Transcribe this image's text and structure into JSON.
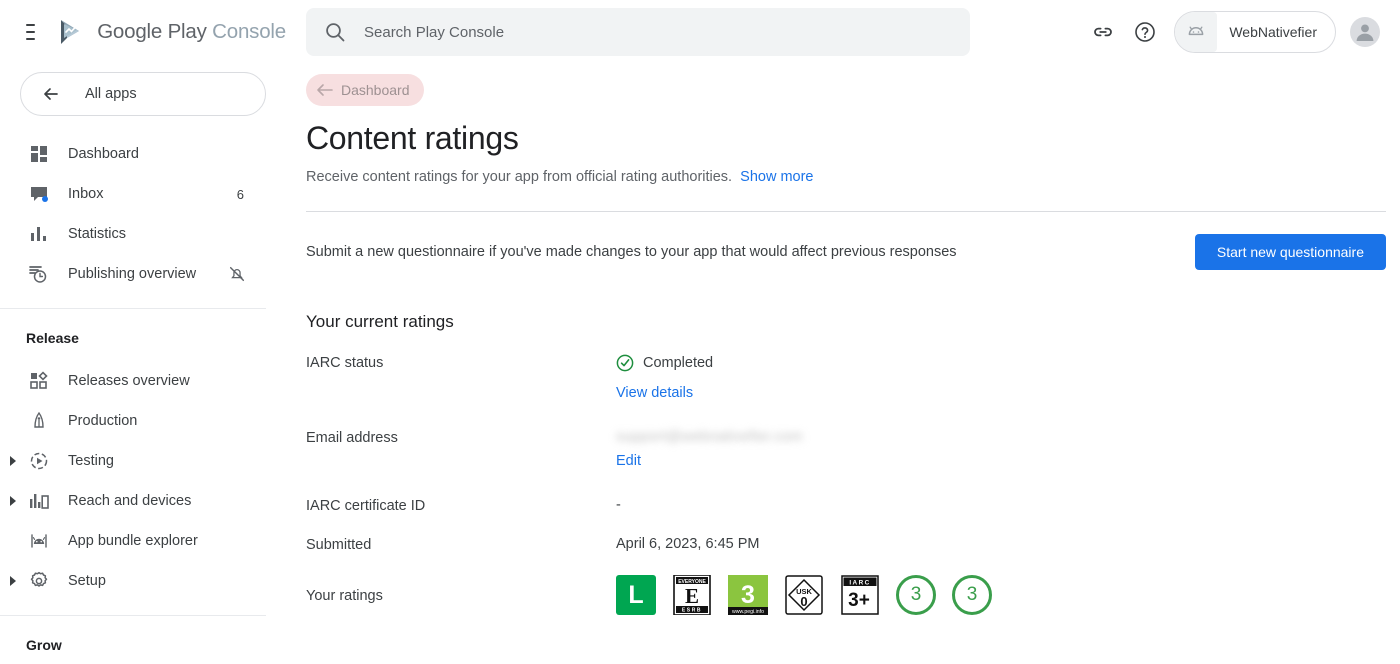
{
  "brand": {
    "google_play": "Google Play",
    "console": "Console"
  },
  "sidebar": {
    "all_apps_label": "All apps",
    "items": [
      {
        "label": "Dashboard",
        "icon": "dashboard-icon",
        "badge": ""
      },
      {
        "label": "Inbox",
        "icon": "inbox-icon",
        "badge": "6"
      },
      {
        "label": "Statistics",
        "icon": "statistics-icon",
        "badge": ""
      },
      {
        "label": "Publishing overview",
        "icon": "publishing-overview-icon",
        "badge": ""
      }
    ],
    "release_section": "Release",
    "release_items": [
      {
        "label": "Releases overview",
        "icon": "releases-overview-icon",
        "expandable": false
      },
      {
        "label": "Production",
        "icon": "rocket-icon",
        "expandable": false
      },
      {
        "label": "Testing",
        "icon": "testing-play-icon",
        "expandable": true
      },
      {
        "label": "Reach and devices",
        "icon": "reach-devices-icon",
        "expandable": true
      },
      {
        "label": "App bundle explorer",
        "icon": "android-bundle-icon",
        "expandable": false
      },
      {
        "label": "Setup",
        "icon": "gear-icon",
        "expandable": true
      }
    ],
    "grow_section": "Grow"
  },
  "topbar": {
    "search_placeholder": "Search Play Console",
    "app_name": "WebNativefier"
  },
  "breadcrumb": {
    "label": "Dashboard"
  },
  "page": {
    "title": "Content ratings",
    "description": "Receive content ratings for your app from official rating authorities.",
    "show_more": "Show more",
    "submit_text": "Submit a new questionnaire if you've made changes to your app that would affect previous responses",
    "start_button": "Start new questionnaire",
    "section_title": "Your current ratings"
  },
  "details": {
    "iarc_status_label": "IARC status",
    "iarc_status_value": "Completed",
    "view_details": "View details",
    "email_label": "Email address",
    "email_value": "support@webnativefier.com",
    "edit": "Edit",
    "certificate_label": "IARC certificate ID",
    "certificate_value": "-",
    "submitted_label": "Submitted",
    "submitted_value": "April 6, 2023, 6:45 PM",
    "ratings_label": "Your ratings"
  },
  "ratings": [
    {
      "name": "classind-l-badge",
      "type": "solid",
      "text": "L",
      "bg": "#00a651",
      "fg": "#ffffff"
    },
    {
      "name": "esrb-everyone-badge",
      "type": "esrb",
      "header": "EVERYONE",
      "text": "E",
      "footer": "ESRB"
    },
    {
      "name": "pegi-3-badge",
      "type": "pegi",
      "text": "3",
      "footer": "www.pegi.info",
      "bg": "#8bc53f"
    },
    {
      "name": "usk-0-badge",
      "type": "usk",
      "header": "USK",
      "text": "0"
    },
    {
      "name": "iarc-3plus-badge",
      "type": "iarc",
      "header": "I A R C",
      "text": "3+"
    },
    {
      "name": "generic-3-circle-badge-1",
      "type": "circle",
      "text": "3",
      "color": "#3a9e4b"
    },
    {
      "name": "generic-3-circle-badge-2",
      "type": "circle",
      "text": "3",
      "color": "#3a9e4b"
    }
  ],
  "colors": {
    "accent_blue": "#1a73e8",
    "success_green": "#1e8e3e",
    "breadcrumb_bg": "#f7dfe0"
  }
}
